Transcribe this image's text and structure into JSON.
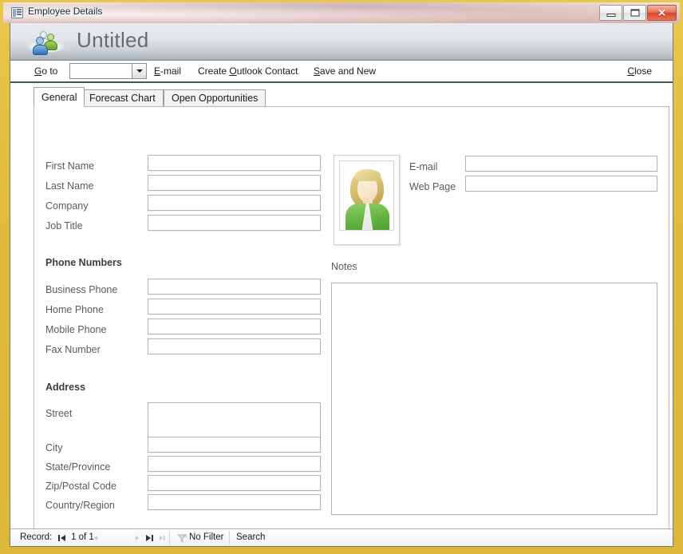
{
  "window": {
    "title": "Employee Details",
    "icon": "access-form-icon",
    "controls": {
      "minimize": "minimize-icon",
      "maximize": "restore-icon",
      "close": "✕"
    }
  },
  "header": {
    "title": "Untitled",
    "icon": "contacts-people-icon"
  },
  "toolbar": {
    "goto_label_pre": "G",
    "goto_label": "o to",
    "goto_value": "",
    "goto_placeholder": "",
    "email_pre": "E",
    "email_label": "-mail",
    "outlook_pre": "Create ",
    "outlook_mid": "O",
    "outlook_post": "utlook Contact",
    "savenew_pre": "S",
    "savenew_label": "ave and New",
    "close_pre": "C",
    "close_label": "lose"
  },
  "tabs": [
    {
      "label": "General",
      "active": true
    },
    {
      "label": "Forecast Chart",
      "active": false
    },
    {
      "label": "Open Opportunities",
      "active": false
    }
  ],
  "form": {
    "identity_fields": [
      {
        "label": "First Name",
        "value": "",
        "focused": true
      },
      {
        "label": "Last Name",
        "value": "",
        "focused": false
      },
      {
        "label": "Company",
        "value": "",
        "focused": false
      },
      {
        "label": "Job Title",
        "value": "",
        "focused": false
      }
    ],
    "phone_section": "Phone Numbers",
    "phone_fields": [
      {
        "label": "Business Phone",
        "value": ""
      },
      {
        "label": "Home Phone",
        "value": ""
      },
      {
        "label": "Mobile Phone",
        "value": ""
      },
      {
        "label": "Fax Number",
        "value": ""
      }
    ],
    "address_section": "Address",
    "address_fields": [
      {
        "label": "Street",
        "value": ""
      },
      {
        "label": "City",
        "value": ""
      },
      {
        "label": "State/Province",
        "value": ""
      },
      {
        "label": "Zip/Postal Code",
        "value": ""
      },
      {
        "label": "Country/Region",
        "value": ""
      }
    ],
    "contact_fields": [
      {
        "label": "E-mail",
        "value": ""
      },
      {
        "label": "Web Page",
        "value": ""
      }
    ],
    "photo_alt": "employee-photo-placeholder",
    "notes_label": "Notes",
    "notes_value": ""
  },
  "statusbar": {
    "record_label": "Record:",
    "record_position": "1 of 1",
    "filter_label": "No Filter",
    "search_label": "Search",
    "nav_first": "first-record-icon",
    "nav_prev": "previous-record-icon",
    "nav_next": "next-record-icon",
    "nav_last": "last-record-icon",
    "nav_new": "new-record-icon",
    "filter_icon": "filter-funnel-icon"
  },
  "colors": {
    "window_frame": "#e0bb3c",
    "header_gradient_top": "#e6eaec",
    "header_gradient_bottom": "#a8b2b9",
    "toolbar_underline": "#3c5a4a",
    "close_button": "#d9452c",
    "field_border": "#b4b4b4",
    "label_text": "#555b60"
  }
}
